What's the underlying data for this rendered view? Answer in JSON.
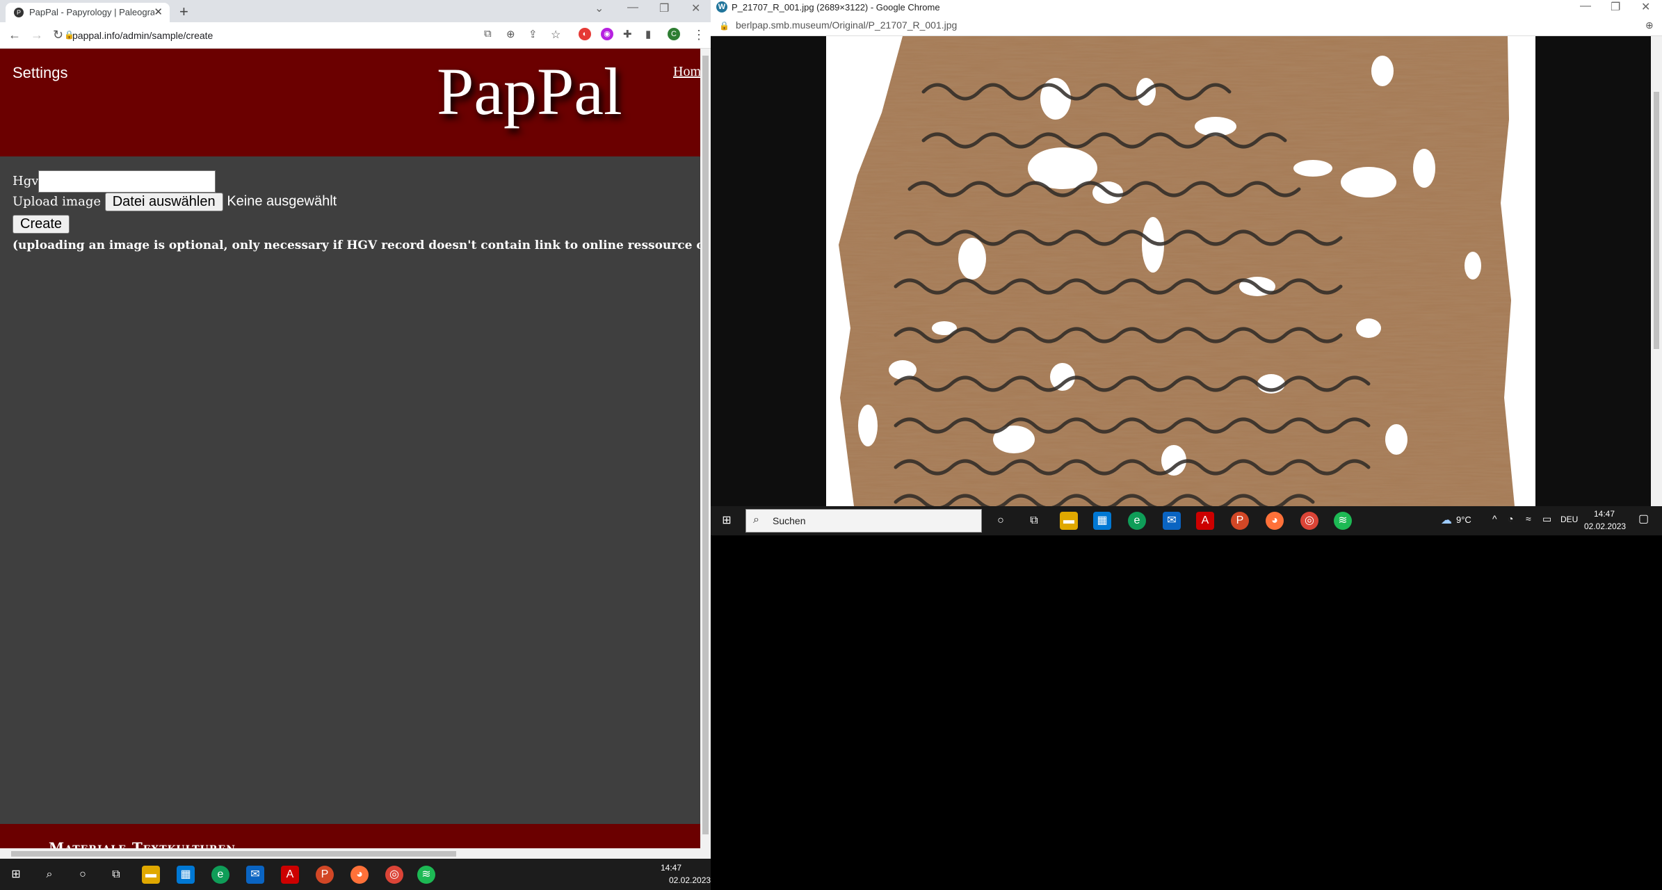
{
  "left_browser": {
    "tab_title": "PapPal - Papyrology | Paleographic",
    "url": "pappal.info/admin/sample/create",
    "profile_initial": "C"
  },
  "site": {
    "settings_label": "Settings",
    "logo_text": "PapPal",
    "home_link": "Home",
    "form": {
      "hgv_label": "Hgv",
      "upload_label": "Upload image",
      "file_button": "Datei auswählen",
      "file_status": "Keine ausgewählt",
      "create_button": "Create",
      "note": "(uploading an image is optional, only necessary if HGV record doesn't contain link to online ressource or if online archive"
    },
    "footer_text": "Materiale Textkulturen"
  },
  "right_browser": {
    "window_title": "P_21707_R_001.jpg (2689×3122) - Google Chrome",
    "url": "berlpap.smb.museum/Original/P_21707_R_001.jpg"
  },
  "taskbar_left": {
    "time": "14:47",
    "date": "02.02.2023"
  },
  "taskbar_right": {
    "search_placeholder": "Suchen",
    "weather": "9°C",
    "language": "DEU",
    "time": "14:47",
    "date": "02.02.2023"
  },
  "colors": {
    "header_bg": "#6b0000",
    "content_bg": "#3f3f3f",
    "papyrus": "#a57a55"
  }
}
